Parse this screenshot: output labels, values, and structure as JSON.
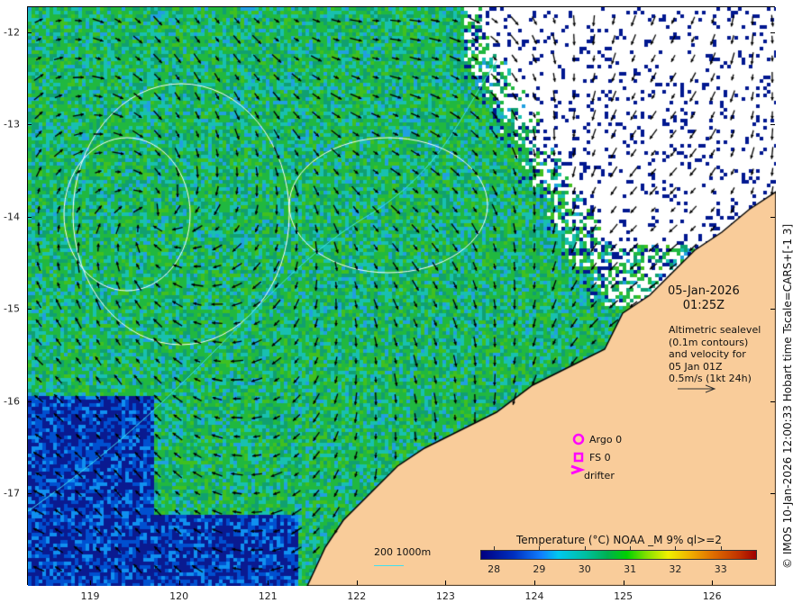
{
  "map": {
    "lon_ticks": [
      "119",
      "120",
      "121",
      "122",
      "123",
      "124",
      "125",
      "126"
    ],
    "lat_ticks": [
      "-12",
      "-13",
      "-14",
      "-15",
      "-16",
      "-17"
    ],
    "lon_range": [
      118.6,
      127.0
    ],
    "lat_range": [
      -11.7,
      -17.99
    ]
  },
  "annotation": {
    "date": "05-Jan-2026",
    "time": "01:25Z",
    "lines": [
      "Altimetric sealevel",
      "(0.1m contours)",
      "and velocity for",
      "05 Jan 01Z",
      "0.5m/s (1kt 24h)"
    ]
  },
  "legend": {
    "argo": "Argo 0",
    "fs": "FS 0",
    "drifter": "drifter",
    "depth_label": "200  1000m"
  },
  "colorbar": {
    "title": "Temperature (°C) NOAA _M 9% ql>=2",
    "ticks": [
      "28",
      "29",
      "30",
      "31",
      "32",
      "33"
    ],
    "range": [
      27.7,
      33.8
    ]
  },
  "side_text": "© IMOS 10-Jan-2026 12:00:33 Hobart time Tscale=CARS+[-1 3]",
  "colors": {
    "land": "#f9cc9a",
    "cloud": "#ffffff",
    "marker": "#ff00ff",
    "contour": "#ffffff",
    "isobath": "#40e0f0"
  }
}
